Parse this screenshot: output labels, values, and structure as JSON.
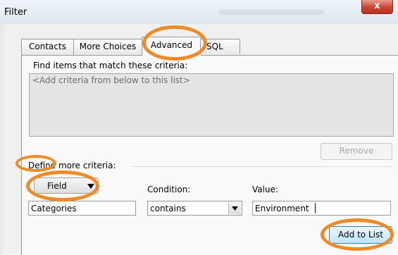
{
  "window": {
    "title": "Filter",
    "close_glyph": "x"
  },
  "tabs": [
    {
      "label": "Contacts",
      "active": false
    },
    {
      "label": "More Choices",
      "active": false
    },
    {
      "label": "Advanced",
      "active": true
    },
    {
      "label": "SQL",
      "active": false
    }
  ],
  "criteria": {
    "heading": "Find items that match these criteria:",
    "list_placeholder": "<Add criteria from below to this list>",
    "remove_label": "Remove"
  },
  "define": {
    "heading": "Define more criteria:",
    "field_button_label": "Field",
    "field_value": "Categories",
    "condition_label": "Condition:",
    "condition_value": "contains",
    "value_label": "Value:",
    "value_value": "Environment",
    "add_label": "Add to List"
  },
  "icons": {
    "dropdown": "dropdown-arrow-icon",
    "close": "close-icon",
    "field_menu": "triangle-down-icon"
  },
  "colors": {
    "highlight_ring": "#f08a24",
    "close_button": "#c94533"
  }
}
